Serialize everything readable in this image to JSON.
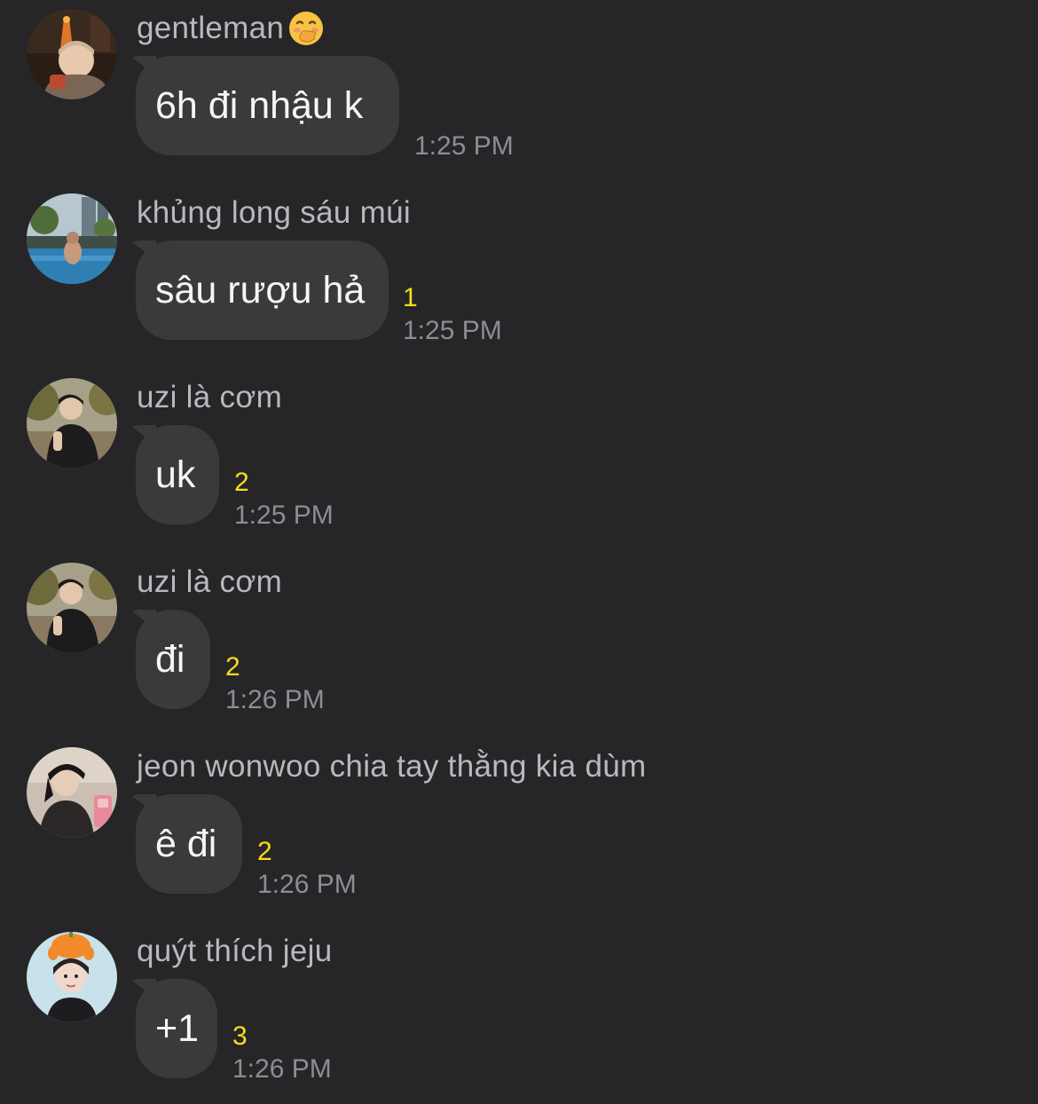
{
  "messages": [
    {
      "sender": "gentleman",
      "sender_emoji": "hand-over-mouth-emoji",
      "text": "6h đi nhậu k",
      "unread": "",
      "time": "1:25 PM"
    },
    {
      "sender": "khủng long sáu múi",
      "text": "sâu rượu hả",
      "unread": "1",
      "time": "1:25 PM"
    },
    {
      "sender": "uzi là cơm",
      "text": "uk",
      "unread": "2",
      "time": "1:25 PM"
    },
    {
      "sender": "uzi là cơm",
      "text": "đi",
      "unread": "2",
      "time": "1:26 PM"
    },
    {
      "sender": "jeon wonwoo chia tay thằng kia dùm",
      "text": "ê đi",
      "unread": "2",
      "time": "1:26 PM"
    },
    {
      "sender": "quýt thích jeju",
      "text": "+1",
      "unread": "3",
      "time": "1:26 PM"
    }
  ],
  "colors": {
    "background": "#262628",
    "bubble": "#3a3a3c",
    "unread": "#f7dc1b",
    "time": "#8d8d92",
    "sender": "#b9b9bd"
  }
}
